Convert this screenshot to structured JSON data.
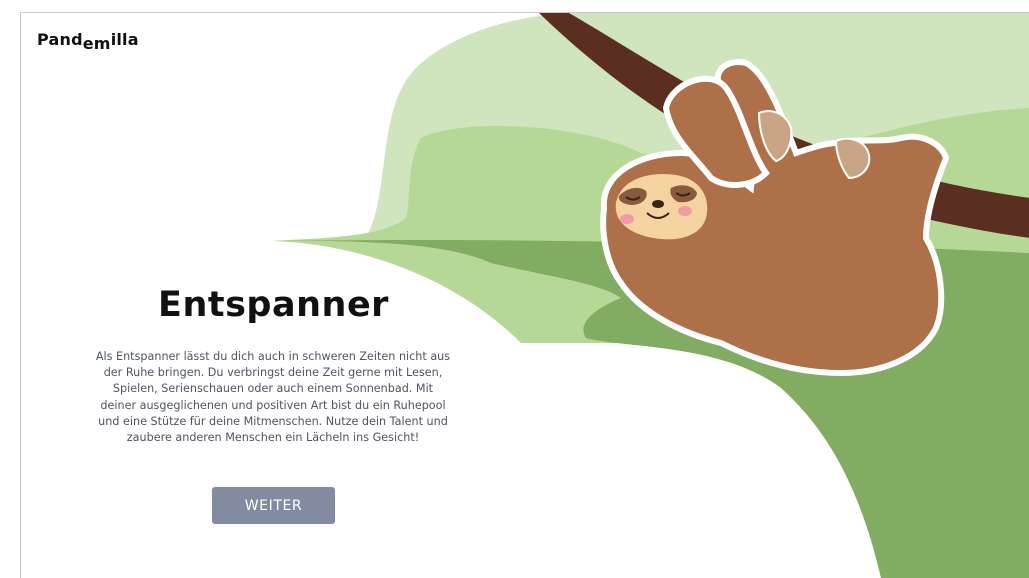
{
  "brand": {
    "logo_main": "Pand",
    "logo_sub": "em",
    "logo_tail": "illa"
  },
  "result": {
    "title": "Entspanner",
    "description": "Als Entspanner lässt du dich auch in schweren Zeiten nicht aus der Ruhe bringen. Du verbringst deine Zeit gerne mit Lesen, Spielen, Serienschauen oder auch einem Sonnenbad. Mit deiner ausgeglichenen und positiven Art bist du ein Ruhepool und eine Stütze für deine Mitmenschen. Nutze dein Talent und zaubere anderen Menschen ein Lächeln ins Gesicht!",
    "button_label": "WEITER"
  },
  "illustration": {
    "icon": "sloth-illustration"
  },
  "colors": {
    "hill_light": "#d0e4bd",
    "hill_mid": "#b6d897",
    "hill_dark": "#82ac62",
    "branch": "#5a2f21",
    "sloth_fur": "#ad7049",
    "sloth_face": "#f4d3a0",
    "button": "#838ba0"
  }
}
